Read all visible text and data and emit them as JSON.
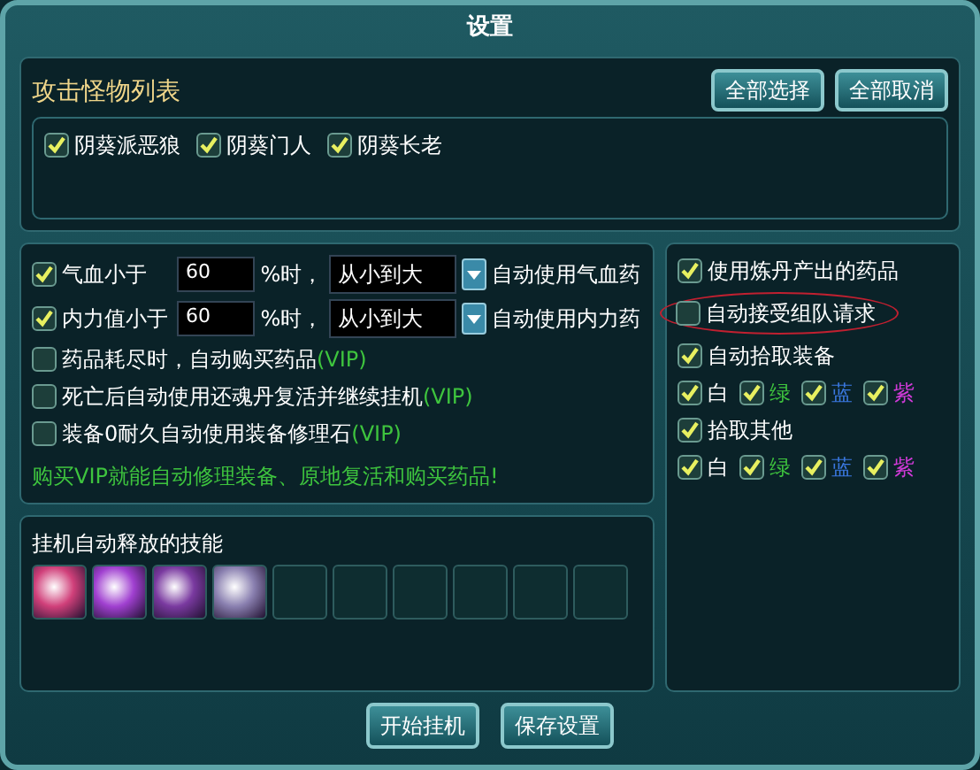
{
  "window": {
    "title": "设置"
  },
  "monster_list": {
    "title": "攻击怪物列表",
    "buttons": [
      "全部选择",
      "全部取消"
    ],
    "items": [
      {
        "label": "阴葵派恶狼",
        "checked": true
      },
      {
        "label": "阴葵门人",
        "checked": true
      },
      {
        "label": "阴葵长老",
        "checked": true
      }
    ]
  },
  "potion_rules": [
    {
      "checked": true,
      "label": "气血小于",
      "value": "60",
      "unit": "%时，",
      "order": "从小到大",
      "action": "自动使用气血药"
    },
    {
      "checked": true,
      "label": "内力值小于",
      "value": "60",
      "unit": "%时，",
      "order": "从小到大",
      "action": "自动使用内力药"
    }
  ],
  "vip_options": [
    {
      "checked": false,
      "label": "药品耗尽时，自动购买药品",
      "tag": "(VIP)"
    },
    {
      "checked": false,
      "label": "死亡后自动使用还魂丹复活并继续挂机",
      "tag": "(VIP)"
    },
    {
      "checked": false,
      "label": "装备0耐久自动使用装备修理石",
      "tag": "(VIP)"
    }
  ],
  "vip_note": "购买VIP就能自动修理装备、原地复活和购买药品!",
  "skills": {
    "title": "挂机自动释放的技能",
    "slots": [
      {
        "filled": true,
        "color": "#d0407a"
      },
      {
        "filled": true,
        "color": "#a040d0"
      },
      {
        "filled": true,
        "color": "#7a3aa0"
      },
      {
        "filled": true,
        "color": "#8a80b0"
      },
      {
        "filled": false
      },
      {
        "filled": false
      },
      {
        "filled": false
      },
      {
        "filled": false
      },
      {
        "filled": false
      },
      {
        "filled": false
      }
    ]
  },
  "right_options": [
    {
      "kind": "option",
      "checked": true,
      "label": "使用炼丹产出的药品",
      "circled": false
    },
    {
      "kind": "option",
      "checked": false,
      "label": "自动接受组队请求",
      "circled": true
    },
    {
      "kind": "option",
      "checked": true,
      "label": "自动拾取装备",
      "circled": false
    },
    {
      "kind": "colors",
      "items": [
        {
          "checked": true,
          "label": "白",
          "color": "#ffffff"
        },
        {
          "checked": true,
          "label": "绿",
          "color": "#3ec43e"
        },
        {
          "checked": true,
          "label": "蓝",
          "color": "#3a78e0"
        },
        {
          "checked": true,
          "label": "紫",
          "color": "#d03ad8"
        }
      ]
    },
    {
      "kind": "option",
      "checked": true,
      "label": "拾取其他",
      "circled": false
    },
    {
      "kind": "colors",
      "items": [
        {
          "checked": true,
          "label": "白",
          "color": "#ffffff"
        },
        {
          "checked": true,
          "label": "绿",
          "color": "#3ec43e"
        },
        {
          "checked": true,
          "label": "蓝",
          "color": "#3a78e0"
        },
        {
          "checked": true,
          "label": "紫",
          "color": "#d03ad8"
        }
      ]
    }
  ],
  "footer_buttons": [
    "开始挂机",
    "保存设置"
  ]
}
